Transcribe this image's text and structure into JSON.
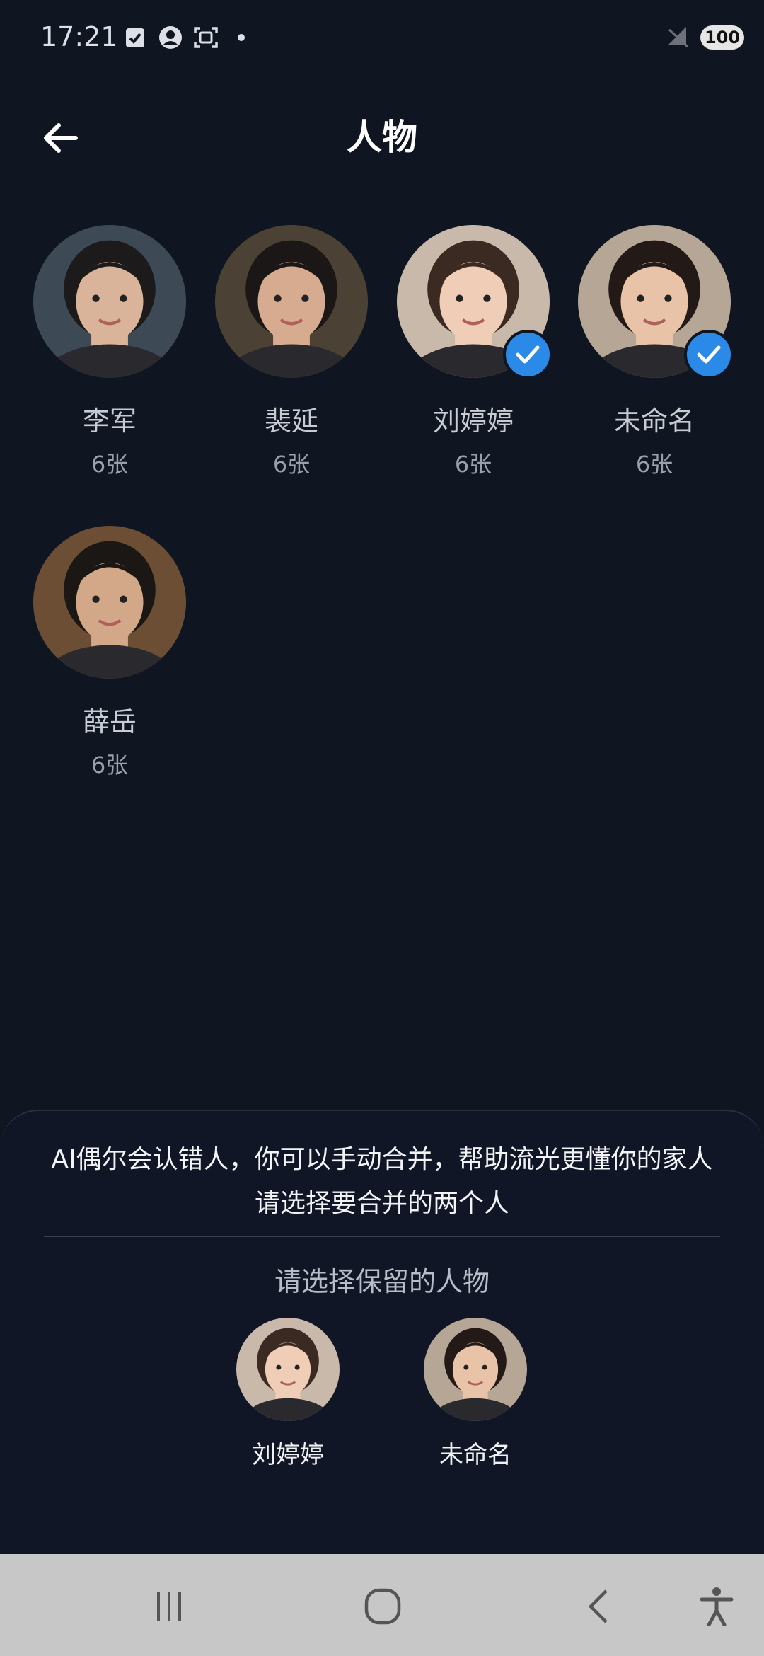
{
  "status_bar": {
    "time": "17:21",
    "battery": "100",
    "icons": [
      "task-check-icon",
      "account-circle-icon",
      "screenshot-icon",
      "dot-icon",
      "no-signal-icon"
    ]
  },
  "header": {
    "title": "人物",
    "back_icon": "arrow-left-icon"
  },
  "people": [
    {
      "name": "李军",
      "count": "6张",
      "selected": false,
      "skin": "#d9b39a",
      "hair": "#1c1a1a",
      "bg": "#3d4a55"
    },
    {
      "name": "裴延",
      "count": "6张",
      "selected": false,
      "skin": "#d6ab8f",
      "hair": "#1a1716",
      "bg": "#4b4235"
    },
    {
      "name": "刘婷婷",
      "count": "6张",
      "selected": true,
      "skin": "#f0cdb6",
      "hair": "#3a2a22",
      "bg": "#c9b9aa"
    },
    {
      "name": "未命名",
      "count": "6张",
      "selected": true,
      "skin": "#e9c3a8",
      "hair": "#231a17",
      "bg": "#b6a696"
    },
    {
      "name": "薛岳",
      "count": "6张",
      "selected": false,
      "skin": "#d2a889",
      "hair": "#1b1715",
      "bg": "#6b4e33"
    }
  ],
  "merge_sheet": {
    "hint": "AI偶尔会认错人，你可以手动合并，帮助流光更懂你的家人请选择要合并的两个人",
    "keep_prompt": "请选择保留的人物",
    "choices": [
      {
        "name": "刘婷婷"
      },
      {
        "name": "未命名"
      }
    ]
  },
  "nav_bar": {
    "buttons": [
      "recents-icon",
      "home-icon",
      "back-icon",
      "accessibility-icon"
    ]
  },
  "colors": {
    "background": "#101522",
    "accent": "#2b8ae8",
    "nav_bar": "#c7c7c7"
  }
}
